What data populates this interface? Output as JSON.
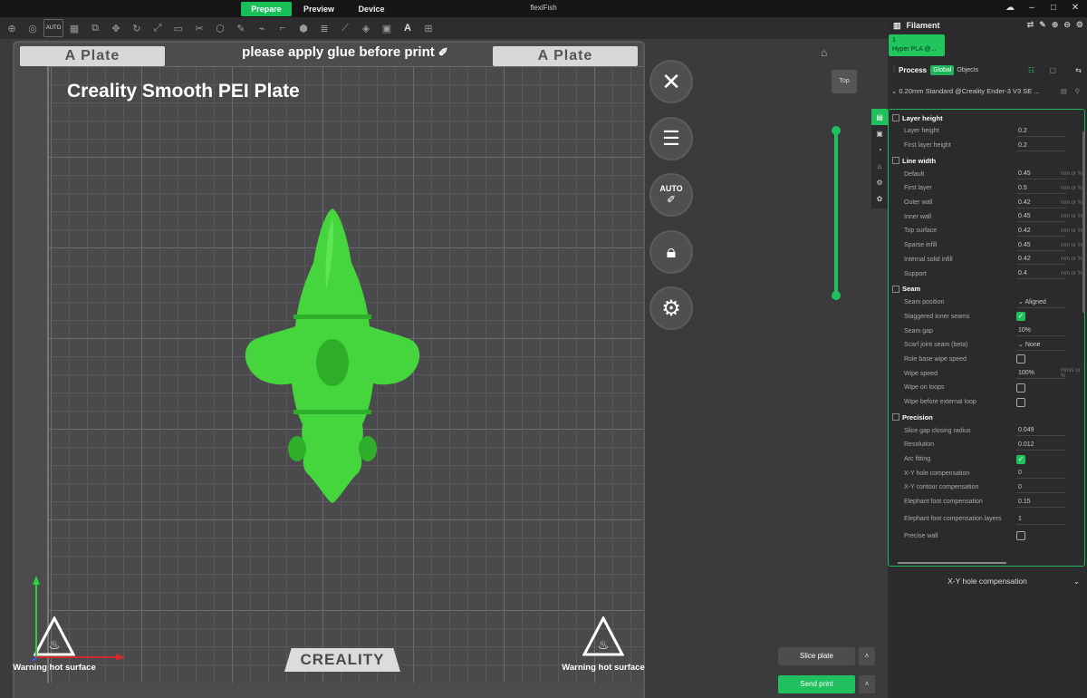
{
  "app": {
    "title": "flexiFish"
  },
  "tabs": [
    {
      "label": "Prepare",
      "active": true
    },
    {
      "label": "Preview",
      "active": false
    },
    {
      "label": "Device",
      "active": false
    }
  ],
  "toolbar": {
    "auto_label": "AUTO"
  },
  "plate": {
    "left_label": "A Plate",
    "right_label": "A Plate",
    "glue_note": "please apply glue before print",
    "name": "Creality Smooth PEI Plate",
    "logo": "CREALITY",
    "warning": "Warning hot surface"
  },
  "side_buttons": {
    "auto": "AUTO"
  },
  "view": {
    "top": "Top"
  },
  "filament": {
    "title": "Filament",
    "slot": "1",
    "name": "Hyper PLA @..."
  },
  "process": {
    "title": "Process",
    "global": "Global",
    "objects": "Objects",
    "preset": "0.20mm Standard @Creality Ender-3 V3 SE ..."
  },
  "sections": {
    "layer_height": "Layer height",
    "line_width": "Line width",
    "seam": "Seam",
    "precision": "Precision"
  },
  "settings": {
    "layer_height": {
      "label": "Layer height",
      "value": "0.2"
    },
    "first_layer_height": {
      "label": "First layer height",
      "value": "0.2"
    },
    "default": {
      "label": "Default",
      "value": "0.45",
      "unit": "mm or %"
    },
    "first_layer": {
      "label": "First layer",
      "value": "0.5",
      "unit": "mm or %"
    },
    "outer_wall": {
      "label": "Outer wall",
      "value": "0.42",
      "unit": "mm or %"
    },
    "inner_wall": {
      "label": "Inner wall",
      "value": "0.45",
      "unit": "mm or %"
    },
    "top_surface": {
      "label": "Top surface",
      "value": "0.42",
      "unit": "mm or %"
    },
    "sparse_infill": {
      "label": "Sparse infill",
      "value": "0.45",
      "unit": "mm or %"
    },
    "internal_solid_infill": {
      "label": "Internal solid infill",
      "value": "0.42",
      "unit": "mm or %"
    },
    "support": {
      "label": "Support",
      "value": "0.4",
      "unit": "mm or %"
    },
    "seam_position": {
      "label": "Seam position",
      "value": "Aligned"
    },
    "staggered": {
      "label": "Staggered inner seams",
      "checked": true
    },
    "seam_gap": {
      "label": "Seam gap",
      "value": "10%"
    },
    "scarf": {
      "label": "Scarf joint seam (beta)",
      "value": "None"
    },
    "role_wipe": {
      "label": "Role base wipe speed",
      "checked": false
    },
    "wipe_speed": {
      "label": "Wipe speed",
      "value": "100%",
      "unit": "mm/s or %"
    },
    "wipe_loops": {
      "label": "Wipe on loops",
      "checked": false
    },
    "wipe_before": {
      "label": "Wipe before external loop",
      "checked": false
    },
    "slice_gap": {
      "label": "Slice gap closing radius",
      "value": "0.049"
    },
    "resolution": {
      "label": "Resolution",
      "value": "0.012"
    },
    "arc_fitting": {
      "label": "Arc fitting",
      "checked": true
    },
    "xy_hole": {
      "label": "X-Y hole compensation",
      "value": "0"
    },
    "xy_contour": {
      "label": "X-Y contour compensation",
      "value": "0"
    },
    "elephant": {
      "label": "Elephant foot compensation",
      "value": "0.15"
    },
    "elephant_layers": {
      "label": "Elephant foot compensation layers",
      "value": "1"
    },
    "precise_wall": {
      "label": "Precise wall",
      "checked": false
    }
  },
  "hint": "X-Y hole compensation",
  "actions": {
    "slice": "Slice plate",
    "send": "Send print"
  },
  "colors": {
    "accent": "#1fc05d",
    "model": "#44d63c"
  }
}
